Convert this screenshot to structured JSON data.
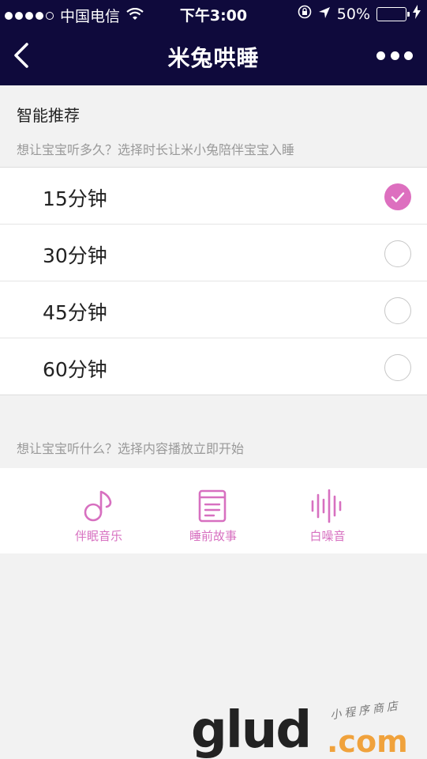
{
  "status_bar": {
    "carrier": "中国电信",
    "time": "下午3:00",
    "battery": "50%"
  },
  "navbar": {
    "title": "米兔哄睡"
  },
  "recommend": {
    "title": "智能推荐",
    "subtitle": "想让宝宝听多久？选择时长让米小兔陪伴宝宝入睡",
    "options": [
      {
        "label": "15分钟",
        "selected": true
      },
      {
        "label": "30分钟",
        "selected": false
      },
      {
        "label": "45分钟",
        "selected": false
      },
      {
        "label": "60分钟",
        "selected": false
      }
    ]
  },
  "content": {
    "subtitle": "想让宝宝听什么？选择内容播放立即开始",
    "categories": [
      {
        "label": "伴眠音乐",
        "icon": "music-note-icon"
      },
      {
        "label": "睡前故事",
        "icon": "book-icon"
      },
      {
        "label": "白噪音",
        "icon": "sound-wave-icon"
      }
    ]
  },
  "colors": {
    "nav_bg": "#0f0a3c",
    "accent": "#dd6fbf",
    "battery_fill": "#4cd964"
  },
  "watermark": {
    "brand": "glud",
    "domain": ".com",
    "tagline": "小程序商店"
  }
}
